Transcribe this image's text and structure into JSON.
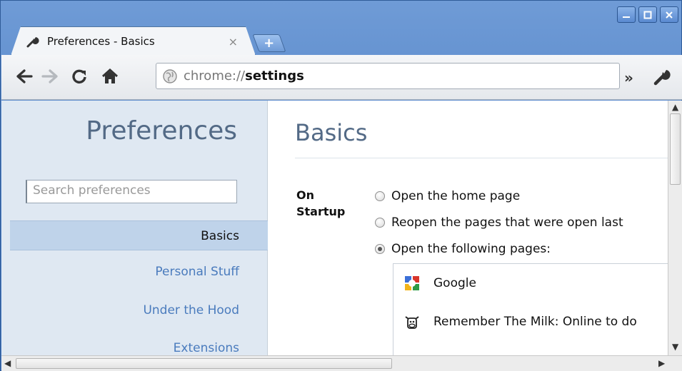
{
  "window": {
    "controls": [
      "minimize",
      "maximize",
      "close"
    ]
  },
  "tabs": [
    {
      "title": "Preferences - Basics",
      "icon": "wrench-icon",
      "close": "×"
    }
  ],
  "new_tab": "+",
  "toolbar": {
    "url_scheme": "chrome://",
    "url_host": "settings",
    "overflow": "»"
  },
  "sidebar": {
    "title": "Preferences",
    "search_placeholder": "Search preferences",
    "items": [
      {
        "label": "Basics",
        "selected": true
      },
      {
        "label": "Personal Stuff",
        "selected": false
      },
      {
        "label": "Under the Hood",
        "selected": false
      },
      {
        "label": "Extensions",
        "selected": false
      }
    ]
  },
  "main": {
    "title": "Basics",
    "startup_label_line1": "On",
    "startup_label_line2": "Startup",
    "options": [
      {
        "label": "Open the home page",
        "checked": false
      },
      {
        "label": "Reopen the pages that were open last",
        "checked": false
      },
      {
        "label": "Open the following pages:",
        "checked": true
      }
    ],
    "pages": [
      {
        "title": "Google",
        "icon": "google-favicon-icon"
      },
      {
        "title": "Remember The Milk: Online to do",
        "icon": "cow-favicon-icon"
      }
    ]
  },
  "colors": {
    "accent": "#4a7bbd",
    "heading": "#536a86",
    "sidebar_bg": "#dfe8f2",
    "selected_bg": "#bfd3ea",
    "titlebar": "#4d7fc4"
  }
}
